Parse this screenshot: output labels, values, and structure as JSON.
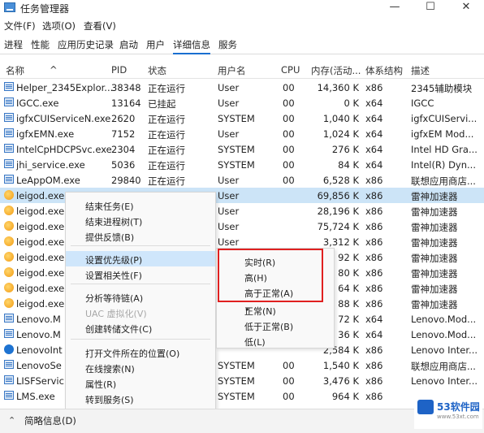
{
  "window": {
    "title": "任务管理器",
    "minimize": "—",
    "maximize": "☐",
    "close": "✕"
  },
  "menu": [
    "文件(F)",
    "选项(O)",
    "查看(V)"
  ],
  "tabs": [
    "进程",
    "性能",
    "应用历史记录",
    "启动",
    "用户",
    "详细信息",
    "服务"
  ],
  "active_tab": "详细信息",
  "columns": [
    "名称",
    "PID",
    "状态",
    "用户名",
    "CPU",
    "内存(活动...",
    "体系结构",
    "描述"
  ],
  "rows": [
    {
      "name": "Helper_2345Explor...",
      "pid": "38348",
      "status": "正在运行",
      "user": "User",
      "cpu": "00",
      "mem": "14,360 K",
      "arch": "x86",
      "desc": "2345辅助模块",
      "icon": "service-icon"
    },
    {
      "name": "IGCC.exe",
      "pid": "13164",
      "status": "已挂起",
      "user": "User",
      "cpu": "00",
      "mem": "0 K",
      "arch": "x64",
      "desc": "IGCC",
      "icon": "service-icon"
    },
    {
      "name": "igfxCUIServiceN.exe",
      "pid": "2620",
      "status": "正在运行",
      "user": "SYSTEM",
      "cpu": "00",
      "mem": "1,040 K",
      "arch": "x64",
      "desc": "igfxCUIServi...",
      "icon": "service-icon"
    },
    {
      "name": "igfxEMN.exe",
      "pid": "7152",
      "status": "正在运行",
      "user": "User",
      "cpu": "00",
      "mem": "1,024 K",
      "arch": "x64",
      "desc": "igfxEM Mod...",
      "icon": "service-icon"
    },
    {
      "name": "IntelCpHDCPSvc.exe",
      "pid": "2304",
      "status": "正在运行",
      "user": "SYSTEM",
      "cpu": "00",
      "mem": "276 K",
      "arch": "x64",
      "desc": "Intel HD Gra...",
      "icon": "service-icon"
    },
    {
      "name": "jhi_service.exe",
      "pid": "5036",
      "status": "正在运行",
      "user": "SYSTEM",
      "cpu": "00",
      "mem": "84 K",
      "arch": "x64",
      "desc": "Intel(R) Dyn...",
      "icon": "service-icon"
    },
    {
      "name": "LeAppOM.exe",
      "pid": "29840",
      "status": "正在运行",
      "user": "User",
      "cpu": "00",
      "mem": "6,528 K",
      "arch": "x86",
      "desc": "联想应用商店...",
      "icon": "service-icon"
    },
    {
      "name": "leigod.exe",
      "pid": "",
      "status": "",
      "user": "User",
      "cpu": "",
      "mem": "69,856 K",
      "arch": "x86",
      "desc": "雷神加速器",
      "icon": "leigod-icon",
      "selected": true
    },
    {
      "name": "leigod.exe",
      "pid": "",
      "status": "",
      "user": "User",
      "cpu": "",
      "mem": "28,196 K",
      "arch": "x86",
      "desc": "雷神加速器",
      "icon": "leigod-icon"
    },
    {
      "name": "leigod.exe",
      "pid": "",
      "status": "",
      "user": "User",
      "cpu": "",
      "mem": "75,724 K",
      "arch": "x86",
      "desc": "雷神加速器",
      "icon": "leigod-icon"
    },
    {
      "name": "leigod.exe",
      "pid": "",
      "status": "",
      "user": "User",
      "cpu": "",
      "mem": "3,312 K",
      "arch": "x86",
      "desc": "雷神加速器",
      "icon": "leigod-icon"
    },
    {
      "name": "leigod.exe",
      "pid": "",
      "status": "",
      "user": "",
      "cpu": "",
      "mem": "92 K",
      "arch": "x86",
      "desc": "雷神加速器",
      "icon": "leigod-icon"
    },
    {
      "name": "leigod.exe",
      "pid": "",
      "status": "",
      "user": "",
      "cpu": "",
      "mem": "80 K",
      "arch": "x86",
      "desc": "雷神加速器",
      "icon": "leigod-icon"
    },
    {
      "name": "leigod.exe",
      "pid": "",
      "status": "",
      "user": "",
      "cpu": "",
      "mem": "64 K",
      "arch": "x86",
      "desc": "雷神加速器",
      "icon": "leigod-icon"
    },
    {
      "name": "leigod.exe",
      "pid": "",
      "status": "",
      "user": "",
      "cpu": "",
      "mem": "88 K",
      "arch": "x86",
      "desc": "雷神加速器",
      "icon": "leigod-icon"
    },
    {
      "name": "Lenovo.M",
      "pid": "",
      "status": "",
      "user": "",
      "cpu": "",
      "mem": "72 K",
      "arch": "x64",
      "desc": "Lenovo.Mod...",
      "icon": "service-icon"
    },
    {
      "name": "Lenovo.M",
      "pid": "",
      "status": "",
      "user": "",
      "cpu": "",
      "mem": "36 K",
      "arch": "x64",
      "desc": "Lenovo.Mod...",
      "icon": "service-icon"
    },
    {
      "name": "LenovoInt",
      "pid": "",
      "status": "",
      "user": "",
      "cpu": "",
      "mem": "2,584 K",
      "arch": "x86",
      "desc": "Lenovo Inter...",
      "icon": "lenovo-icon"
    },
    {
      "name": "LenovoSe",
      "pid": "",
      "status": "",
      "user": "SYSTEM",
      "cpu": "00",
      "mem": "1,540 K",
      "arch": "x86",
      "desc": "联想应用商店...",
      "icon": "service-icon"
    },
    {
      "name": "LISFServic",
      "pid": "",
      "status": "",
      "user": "SYSTEM",
      "cpu": "00",
      "mem": "3,476 K",
      "arch": "x86",
      "desc": "Lenovo Inter...",
      "icon": "service-icon"
    },
    {
      "name": "LMS.exe",
      "pid": "",
      "status": "",
      "user": "SYSTEM",
      "cpu": "00",
      "mem": "964 K",
      "arch": "x86",
      "desc": "",
      "icon": "service-icon"
    }
  ],
  "context_menu": [
    {
      "label": "结束任务(E)"
    },
    {
      "label": "结束进程树(T)"
    },
    {
      "label": "提供反馈(B)"
    },
    {
      "label": "设置优先级(P)",
      "highlighted": true,
      "separator_before": true
    },
    {
      "label": "设置相关性(F)"
    },
    {
      "label": "分析等待链(A)",
      "separator_before": true
    },
    {
      "label": "UAC 虚拟化(V)",
      "disabled": true
    },
    {
      "label": "创建转储文件(C)"
    },
    {
      "label": "打开文件所在的位置(O)",
      "separator_before": true
    },
    {
      "label": "在线搜索(N)"
    },
    {
      "label": "属性(R)"
    },
    {
      "label": "转到服务(S)"
    }
  ],
  "priority_menu": [
    {
      "label": "实时(R)"
    },
    {
      "label": "高(H)"
    },
    {
      "label": "高于正常(A)"
    },
    {
      "label": "正常(N)",
      "checked": true
    },
    {
      "label": "低于正常(B)"
    },
    {
      "label": "低(L)"
    }
  ],
  "annotation": {
    "box_color": "#e02020",
    "arrow_color": "#e02020"
  },
  "footer": {
    "summary": "简略信息(D)"
  },
  "watermark": {
    "site": "53软件园",
    "url": "www.53xt.com"
  }
}
